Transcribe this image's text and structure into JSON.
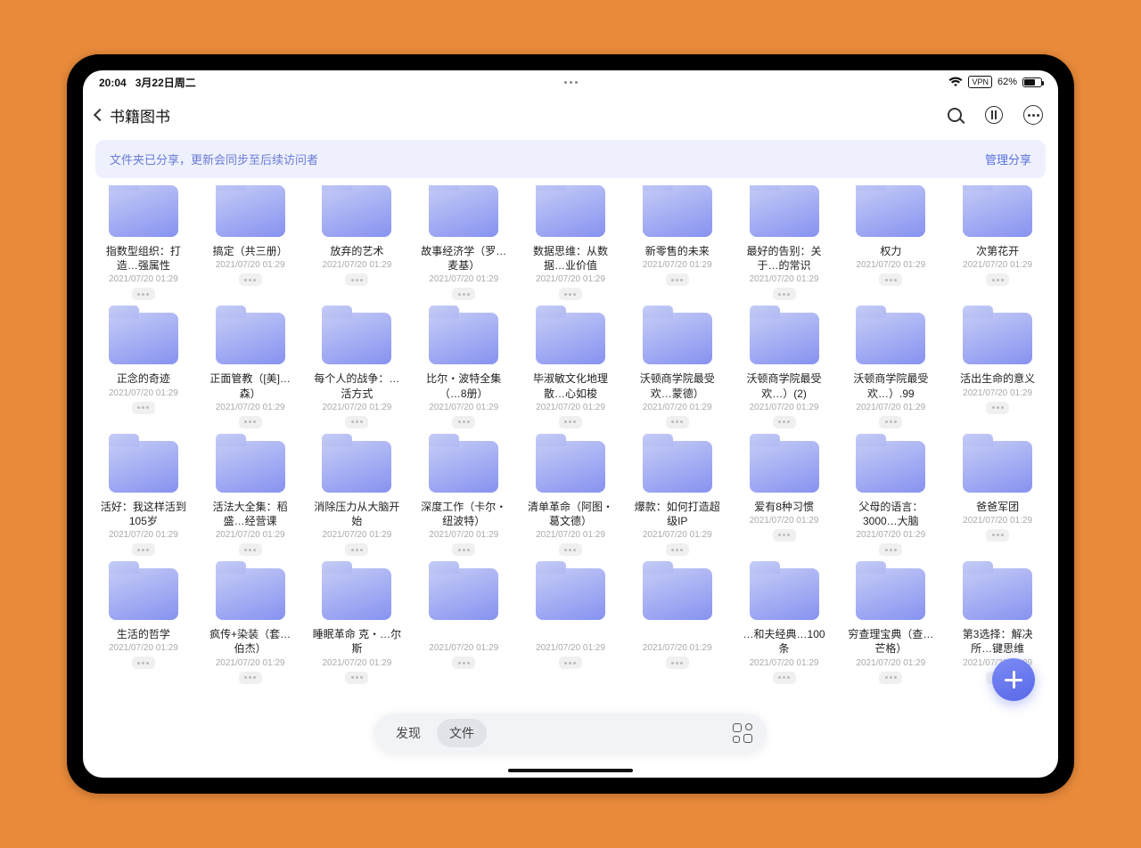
{
  "status": {
    "time": "20:04",
    "date": "3月22日周二",
    "vpn": "VPN",
    "battery_pct": "62%"
  },
  "header": {
    "title": "书籍图书"
  },
  "banner": {
    "msg": "文件夹已分享，更新会同步至后续访问者",
    "action": "管理分享"
  },
  "item_date": "2021/07/20 01:29",
  "items": [
    "指数型组织：打造…强属性",
    "搞定（共三册）",
    "放弃的艺术",
    "故事经济学（罗…麦基）",
    "数据思维：从数据…业价值",
    "新零售的未来",
    "最好的告别：关于…的常识",
    "权力",
    "次第花开",
    "正念的奇迹",
    "正面管教（[美]…森）",
    "每个人的战争：…活方式",
    "比尔・波特全集（…8册）",
    "毕淑敏文化地理散…心如梭",
    "沃顿商学院最受欢…蒙德）",
    "沃顿商学院最受欢…）(2)",
    "沃顿商学院最受欢…）.99",
    "活出生命的意义",
    "活好：我这样活到105岁",
    "活法大全集：稻盛…经营课",
    "消除压力从大脑开始",
    "深度工作（卡尔・纽波特）",
    "清单革命（阿图・葛文德）",
    "爆款：如何打造超级IP",
    "爱有8种习惯",
    "父母的语言：3000…大脑",
    "爸爸军团",
    "生活的哲学",
    "疯传+染装（套…伯杰）",
    "睡眠革命 克・…尔斯",
    "",
    "",
    "",
    "…和夫经典…100条",
    "穷查理宝典（查…芒格）",
    "第3选择：解决所…键思维"
  ],
  "bottom": {
    "tab1": "发现",
    "tab2": "文件"
  }
}
